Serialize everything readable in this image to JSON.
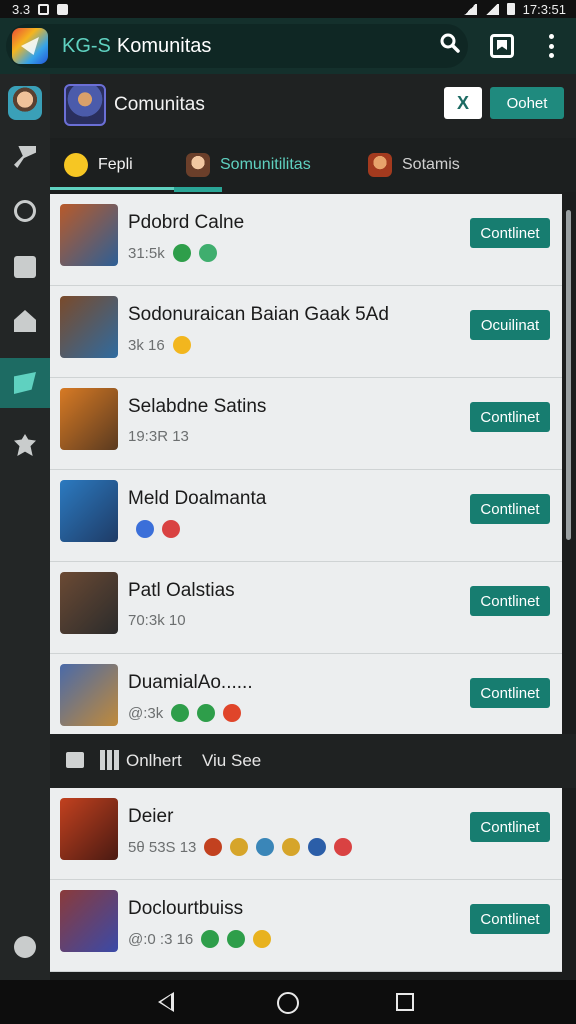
{
  "status": {
    "left_text": "3.3",
    "time": "17:3:51"
  },
  "appbar": {
    "title_prefix": "KG-S",
    "title": "Komunitas"
  },
  "header": {
    "title": "Comunitas",
    "close_label": "X",
    "top_button": "Oohet"
  },
  "tabs": [
    {
      "label": "Fepli"
    },
    {
      "label": "Somunitilitas"
    },
    {
      "label": "Sotamis"
    }
  ],
  "rows": [
    {
      "name": "Pdobrd Calne",
      "meta": "31:5k",
      "button": "Contlinet",
      "thumb": "#b85a2a",
      "thumb2": "#2d5f96",
      "dots": [
        "#2e9e4a",
        "#3fae6e"
      ]
    },
    {
      "name": "Sodonuraican Baian Gaak 5Ad",
      "meta": "3k 16",
      "button": "Ocuilinat",
      "thumb": "#7a4a2a",
      "thumb2": "#2f6ba0",
      "dots": [
        "#f2b61e"
      ]
    },
    {
      "name": "Selabdne Satins",
      "meta": "19:3R 13",
      "button": "Contlinet",
      "thumb": "#d77a24",
      "thumb2": "#5a3a20",
      "dots": []
    },
    {
      "name": "Meld Doalmanta",
      "meta": "",
      "button": "Contlinet",
      "thumb": "#2c7ac0",
      "thumb2": "#1e3b66",
      "dots": [
        "#3b6fd9",
        "#d94242"
      ]
    },
    {
      "name": "Patl Oalstias",
      "meta": "70:3k 10",
      "button": "Contlinet",
      "thumb": "#6b4a34",
      "thumb2": "#2b2b2b",
      "dots": []
    },
    {
      "name": "DuamialAo......",
      "meta": "@:3k",
      "button": "Contlinet",
      "thumb": "#4a6aa8",
      "thumb2": "#c08a3a",
      "dots": [
        "#2e9e4a",
        "#2e9e4a",
        "#e0452a"
      ]
    }
  ],
  "subbar": {
    "label1": "Onlhert",
    "label2": "Viu See"
  },
  "rows2": [
    {
      "name": "Deier",
      "meta": "5θ 53S 13",
      "button": "Contlinet",
      "thumb": "#c2411f",
      "thumb2": "#4a1a12",
      "dots": [
        "#c2411f",
        "#d6a52a",
        "#3a86b8",
        "#d6a52a",
        "#2b5ea8",
        "#d94242"
      ]
    },
    {
      "name": "Doclourtbuiss",
      "meta": "@:0 :3 16",
      "button": "Contlinet",
      "thumb": "#8a3a3a",
      "thumb2": "#3a4aa8",
      "dots": [
        "#2e9e4a",
        "#2e9e4a",
        "#e8b21e"
      ]
    }
  ],
  "icons": [
    "search-icon",
    "bookmark-icon",
    "more-icon",
    "back-icon",
    "home-icon",
    "recents-icon"
  ]
}
